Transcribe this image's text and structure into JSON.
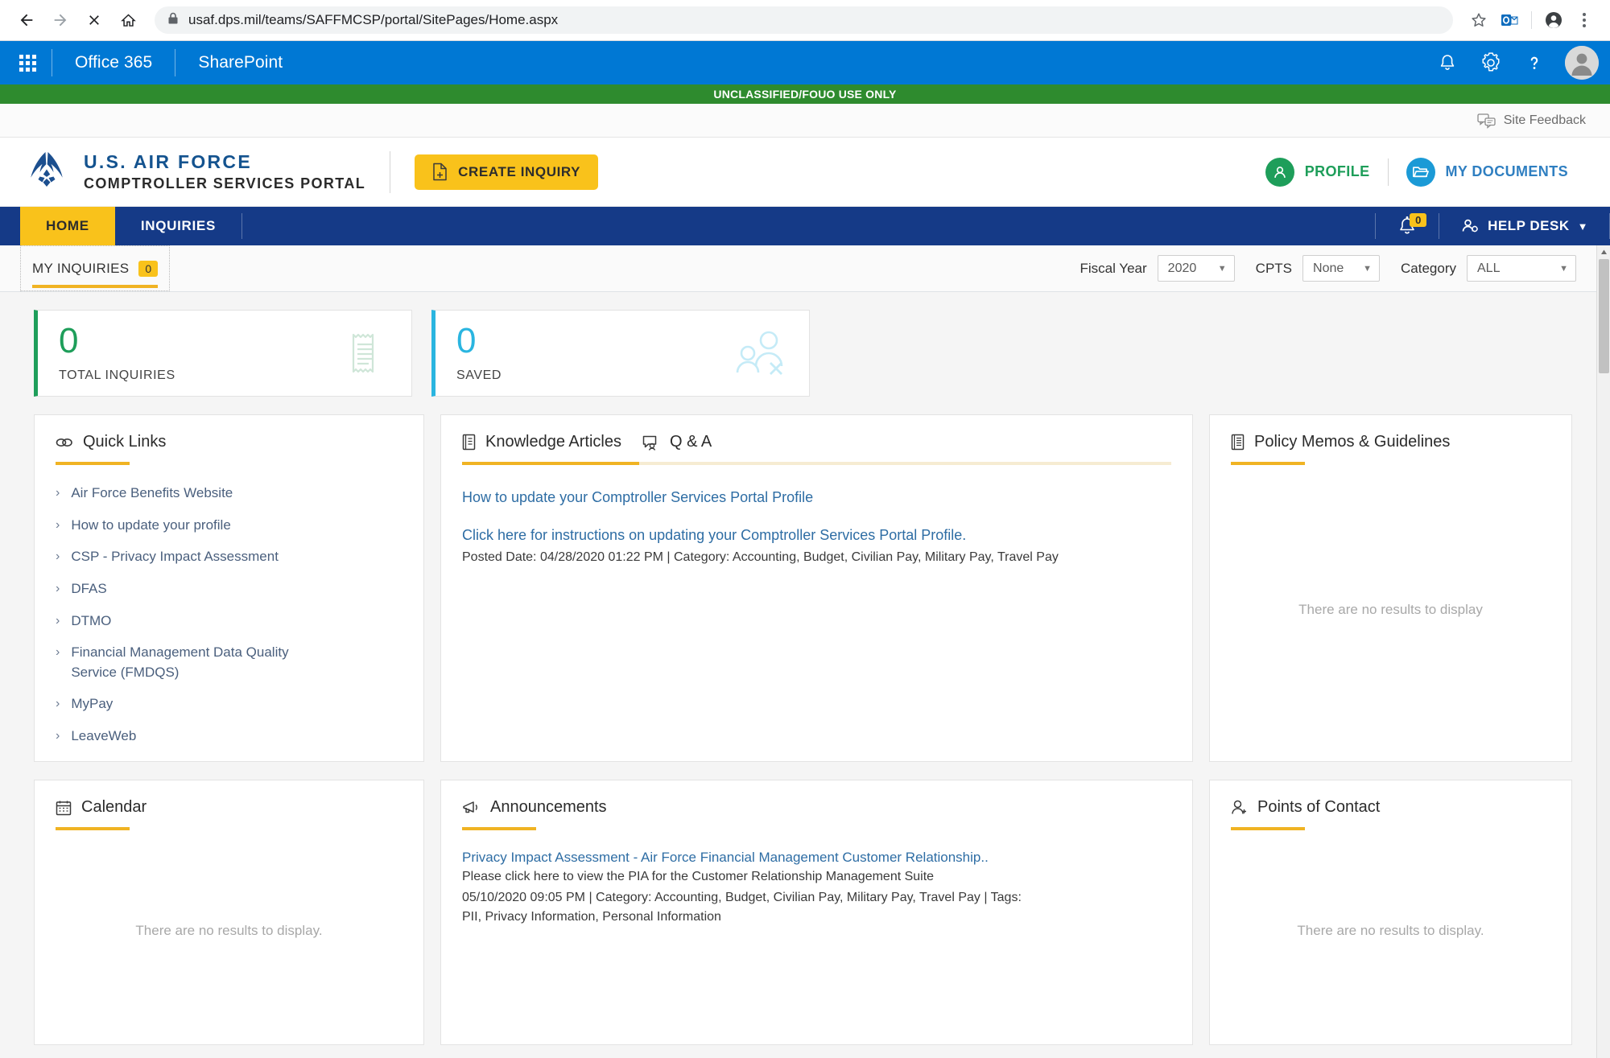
{
  "browser": {
    "url": "usaf.dps.mil/teams/SAFFMCSP/portal/SitePages/Home.aspx",
    "back_icon": "back-arrow-icon",
    "forward_icon": "forward-arrow-icon",
    "stop_icon": "stop-x-icon",
    "home_icon": "home-icon",
    "lock_icon": "lock-icon",
    "bookmark_icon": "star-icon",
    "extension_icon": "outlook-extension-icon",
    "profile_icon": "browser-profile-icon",
    "menu_icon": "three-dot-menu-icon"
  },
  "suite_bar": {
    "waffle_icon": "app-launcher-icon",
    "brand": "Office 365",
    "app": "SharePoint",
    "notifications_icon": "bell-icon",
    "settings_icon": "gear-icon",
    "help_icon": "question-mark-icon",
    "avatar_icon": "user-avatar-icon",
    "background": "#0078d4"
  },
  "classification": {
    "text": "UNCLASSIFIED/FOUO USE ONLY",
    "background": "#2e8b2e"
  },
  "feedback": {
    "icon": "feedback-bubble-icon",
    "label": "Site Feedback"
  },
  "af_header": {
    "logo_icon": "air-force-wings-logo",
    "title_line1": "U.S. AIR FORCE",
    "title_line2": "COMPTROLLER SERVICES PORTAL",
    "create_inquiry": {
      "label": "CREATE INQUIRY",
      "icon": "new-document-icon",
      "background": "#f9c21b"
    },
    "profile": {
      "label": "PROFILE",
      "icon": "person-icon",
      "color": "#1e9e5a"
    },
    "my_documents": {
      "label": "MY DOCUMENTS",
      "icon": "folder-open-icon",
      "color": "#1b9ad6"
    }
  },
  "nav": {
    "tabs": [
      {
        "label": "HOME",
        "active": true
      },
      {
        "label": "INQUIRIES",
        "active": false
      }
    ],
    "notification_icon": "alert-bell-icon",
    "notification_count": "0",
    "help_desk": {
      "label": "HELP DESK",
      "icon": "person-gear-icon",
      "caret": "▼"
    },
    "background": "#153a87"
  },
  "filters": {
    "my_inquiries": {
      "label": "MY INQUIRIES",
      "count": "0"
    },
    "fiscal_year": {
      "label": "Fiscal Year",
      "value": "2020"
    },
    "cpts": {
      "label": "CPTS",
      "value": "None"
    },
    "category": {
      "label": "Category",
      "value": "ALL"
    },
    "caret": "▼"
  },
  "stats": [
    {
      "value": "0",
      "label": "TOTAL INQUIRIES",
      "color": "#1e9e5a",
      "icon": "receipt-icon"
    },
    {
      "value": "0",
      "label": "SAVED",
      "color": "#2ab5e0",
      "icon": "people-remove-icon"
    }
  ],
  "panels": {
    "quick_links": {
      "title": "Quick Links",
      "icon": "link-chain-icon",
      "items": [
        "Air Force Benefits Website",
        "How to update your profile",
        "CSP - Privacy Impact Assessment",
        "DFAS",
        "DTMO",
        "Financial Management Data Quality Service (FMDQS)",
        "MyPay",
        "LeaveWeb"
      ]
    },
    "knowledge_articles": {
      "title": "Knowledge Articles",
      "icon": "book-icon",
      "qa_title": "Q & A",
      "qa_icon": "qa-speech-icon",
      "article_title": "How to update your Comptroller Services Portal Profile",
      "article_link": "Click here for instructions on updating your Comptroller Services Portal Profile.",
      "article_meta": "Posted Date: 04/28/2020 01:22 PM | Category: Accounting, Budget, Civilian Pay, Military Pay, Travel Pay"
    },
    "policy_memos": {
      "title": "Policy Memos & Guidelines",
      "icon": "document-lines-icon",
      "empty": "There are no results to display"
    },
    "calendar": {
      "title": "Calendar",
      "icon": "calendar-icon",
      "empty": "There are no results to display."
    },
    "announcements": {
      "title": "Announcements",
      "icon": "megaphone-icon",
      "item_title": "Privacy Impact Assessment - Air Force Financial Management Customer Relationship..",
      "item_sub": "Please click here to view the PIA for the Customer Relationship Management Suite",
      "item_meta": "05/10/2020 09:05 PM | Category: Accounting, Budget, Civilian Pay, Military Pay, Travel Pay | Tags: PII, Privacy Information, Personal Information"
    },
    "points_of_contact": {
      "title": "Points of Contact",
      "icon": "person-add-icon",
      "empty": "There are no results to display."
    }
  },
  "scrollbar": {
    "up_arrow": "▲",
    "down_arrow": "▼"
  }
}
